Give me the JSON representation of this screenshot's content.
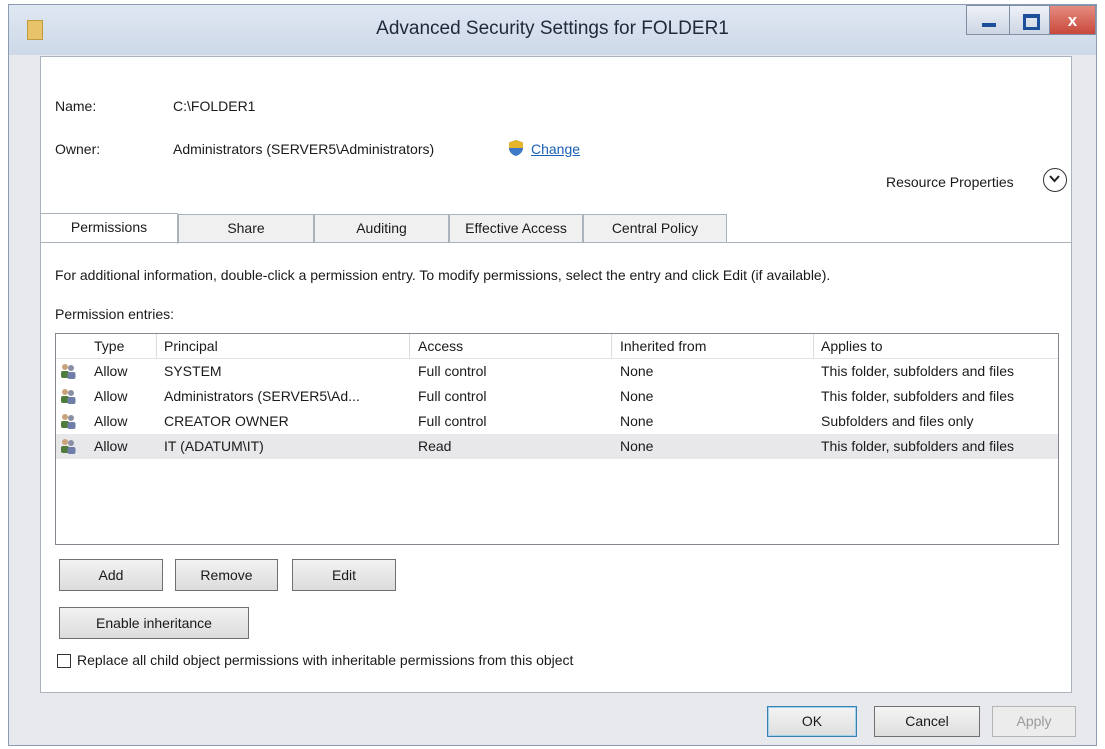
{
  "window": {
    "title": "Advanced Security Settings for FOLDER1",
    "minimize_icon": "minimize-icon",
    "maximize_icon": "maximize-icon",
    "close_glyph": "x"
  },
  "details": {
    "name_label": "Name:",
    "name_value": "C:\\FOLDER1",
    "owner_label": "Owner:",
    "owner_value": "Administrators (SERVER5\\Administrators)",
    "change_label": "Change",
    "resource_properties_label": "Resource Properties"
  },
  "tabs": [
    {
      "label": "Permissions"
    },
    {
      "label": "Share"
    },
    {
      "label": "Auditing"
    },
    {
      "label": "Effective Access"
    },
    {
      "label": "Central Policy"
    }
  ],
  "permissions": {
    "info_text": "For additional information, double-click a permission entry. To modify permissions, select the entry and click Edit (if available).",
    "entries_label": "Permission entries:",
    "columns": [
      "Type",
      "Principal",
      "Access",
      "Inherited from",
      "Applies to"
    ],
    "entries": [
      {
        "type": "Allow",
        "principal": "SYSTEM",
        "access": "Full control",
        "inherited_from": "None",
        "applies_to": "This folder, subfolders and files"
      },
      {
        "type": "Allow",
        "principal": "Administrators (SERVER5\\Ad...",
        "access": "Full control",
        "inherited_from": "None",
        "applies_to": "This folder, subfolders and files"
      },
      {
        "type": "Allow",
        "principal": "CREATOR OWNER",
        "access": "Full control",
        "inherited_from": "None",
        "applies_to": "Subfolders and files only"
      },
      {
        "type": "Allow",
        "principal": "IT (ADATUM\\IT)",
        "access": "Read",
        "inherited_from": "None",
        "applies_to": "This folder, subfolders and files"
      }
    ],
    "add_label": "Add",
    "remove_label": "Remove",
    "edit_label": "Edit",
    "enable_inheritance_label": "Enable inheritance",
    "replace_checkbox_label": "Replace all child object permissions with inheritable permissions from this object"
  },
  "footer": {
    "ok_label": "OK",
    "cancel_label": "Cancel",
    "apply_label": "Apply"
  },
  "colors": {
    "link": "#1a5fb4",
    "close_button": "#c8483a"
  }
}
